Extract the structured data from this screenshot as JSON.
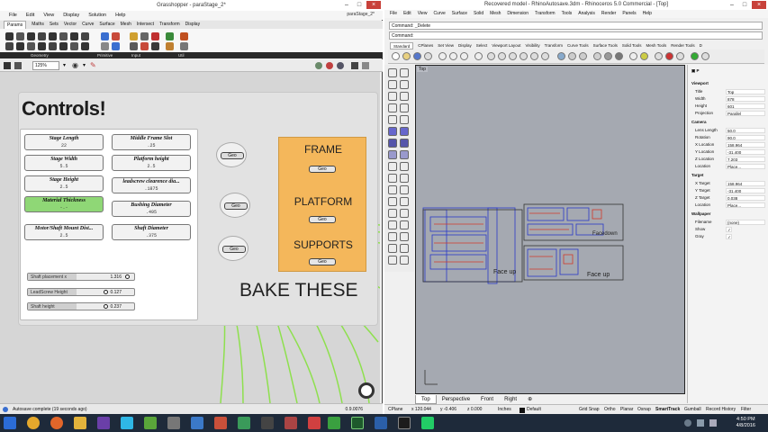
{
  "grasshopper": {
    "title": "Grasshopper - paraStage_2*",
    "doc_name": "paraStage_2*",
    "menu": [
      "File",
      "Edit",
      "View",
      "Display",
      "Solution",
      "Help"
    ],
    "tabs": [
      "Params",
      "Maths",
      "Sets",
      "Vector",
      "Curve",
      "Surface",
      "Mesh",
      "Intersect",
      "Transform",
      "Display"
    ],
    "categories": [
      "Geometry",
      "Primitive",
      "Input",
      "Util"
    ],
    "zoom": "125%",
    "status": "Autosave complete (19 seconds ago)",
    "version": "0.9.0076"
  },
  "canvas": {
    "group_title": "Controls!",
    "panels_left": [
      {
        "title": "Stage Length",
        "value": "22"
      },
      {
        "title": "Stage Width",
        "value": "5.5"
      },
      {
        "title": "Stage Height",
        "value": "2.5"
      },
      {
        "title": "Material Thickness",
        "value": "-.-"
      },
      {
        "title": "Motor/Shaft Mount Dist...",
        "value": "2.5"
      }
    ],
    "panels_right": [
      {
        "title": "Middle Frame Slot",
        "value": ".25"
      },
      {
        "title": "Platform height",
        "value": "2.5"
      },
      {
        "title": "leadscrew clearence dia...",
        "value": ".1875"
      },
      {
        "title": "Bushing Diameter",
        "value": ".495"
      },
      {
        "title": "Shaft Diameter",
        "value": ".375"
      }
    ],
    "sliders": [
      {
        "label": "Shaft placement x",
        "value": "1.316"
      },
      {
        "label": "LeadScrew Height",
        "value": "0.127"
      },
      {
        "label": "Shaft height",
        "value": "0.237"
      }
    ],
    "geo_label": "Geo",
    "bake_items": [
      "FRAME",
      "PLATFORM",
      "SUPPORTS"
    ],
    "bake_caption": "BAKE THESE"
  },
  "rhino": {
    "title": "Recovered model - RhinoAutosave.3dm - Rhinoceros 5.0 Commercial - [Top]",
    "menu": [
      "File",
      "Edit",
      "View",
      "Curve",
      "Surface",
      "Solid",
      "Mesh",
      "Dimension",
      "Transform",
      "Tools",
      "Analysis",
      "Render",
      "Panels",
      "Help"
    ],
    "command_history": "Command: _Delete",
    "command_prompt": "Command:",
    "toolbar_tabs": [
      "Standard",
      "CPlanes",
      "Set View",
      "Display",
      "Select",
      "Viewport Layout",
      "Visibility",
      "Transform",
      "Curve Tools",
      "Surface Tools",
      "Solid Tools",
      "Mesh Tools",
      "Render Tools",
      "D"
    ],
    "viewport_label": "Top",
    "viewport_tabs": [
      "Top",
      "Perspective",
      "Front",
      "Right"
    ],
    "face_labels": [
      "Face up",
      "Facedown",
      "Face up"
    ],
    "status": {
      "cplane": "CPlane",
      "x": "x 120.044",
      "y": "y -0.406",
      "z": "z 0.000",
      "units": "Inches",
      "layer": "Default",
      "toggles": [
        "Grid Snap",
        "Ortho",
        "Planar",
        "Osnap",
        "SmartTrack",
        "Gumball",
        "Record History",
        "Filter"
      ]
    },
    "properties": {
      "sections": [
        "Viewport",
        "Camera",
        "Target",
        "Wallpaper"
      ],
      "viewport": [
        [
          "Title",
          "Top"
        ],
        [
          "Width",
          "878"
        ],
        [
          "Height",
          "601"
        ],
        [
          "Projection",
          "Parallel"
        ]
      ],
      "camera": [
        [
          "Lens Length",
          "50.0"
        ],
        [
          "Rotation",
          "90.0"
        ],
        [
          "X Location",
          "158.964"
        ],
        [
          "Y Location",
          "-31.400"
        ],
        [
          "Z Location",
          "7.203"
        ],
        [
          "Location",
          "Place..."
        ]
      ],
      "target": [
        [
          "X Target",
          "158.964"
        ],
        [
          "Y Target",
          "-31.400"
        ],
        [
          "Z Target",
          "0.038"
        ],
        [
          "Location",
          "Place..."
        ]
      ],
      "wallpaper": [
        [
          "Filename",
          "(none)"
        ],
        [
          "Show",
          ""
        ],
        [
          "Gray",
          ""
        ]
      ]
    }
  },
  "taskbar": {
    "time": "4:50 PM",
    "date": "4/8/2016"
  },
  "colors": {
    "bake_orange": "#f4b75b",
    "wire_green": "#7ed63c",
    "viewport_grey": "#a5a9b1",
    "rhino_blue": "#2a3ac8",
    "rhino_red": "#d23a2a"
  }
}
